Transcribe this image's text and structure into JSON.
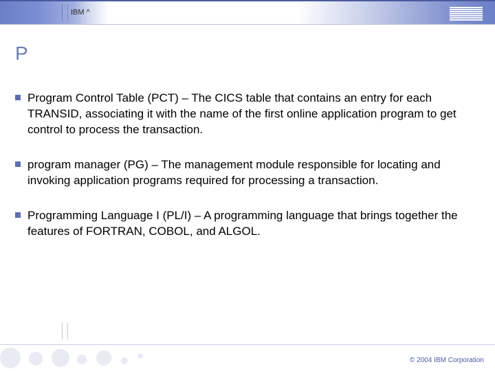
{
  "header": {
    "brand_label": "IBM ^",
    "logo_name": "IBM"
  },
  "title": "P",
  "items": [
    {
      "text": "Program Control Table (PCT) – The CICS table that contains an entry for each TRANSID, associating it with the name of the first online application program to get control to process the transaction."
    },
    {
      "text": "program manager (PG) – The management module responsible for locating and invoking application programs required for processing a transaction."
    },
    {
      "text": "Programming Language I (PL/I) – A programming language that brings together the features of FORTRAN, COBOL, and ALGOL."
    }
  ],
  "footer": {
    "copyright": "© 2004 IBM Corporation"
  }
}
